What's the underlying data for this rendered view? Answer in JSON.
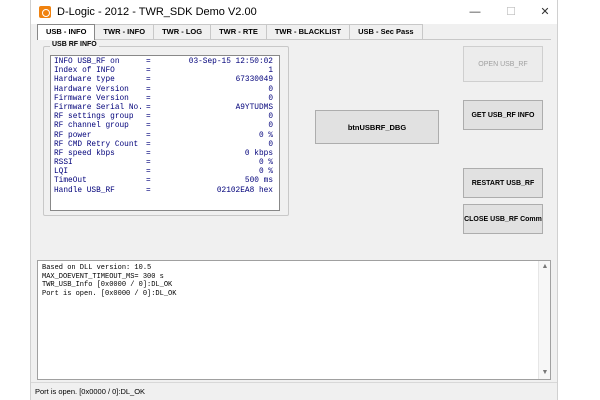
{
  "window": {
    "title": "D-Logic - 2012 - TWR_SDK Demo V2.00",
    "minimize_glyph": "—",
    "maximize_glyph": "☐",
    "close_glyph": "✕"
  },
  "tabs": [
    {
      "label": "USB - INFO",
      "active": true
    },
    {
      "label": "TWR - INFO",
      "active": false
    },
    {
      "label": "TWR - LOG",
      "active": false
    },
    {
      "label": "TWR - RTE",
      "active": false
    },
    {
      "label": "TWR - BLACKLIST",
      "active": false
    },
    {
      "label": "USB - Sec Pass",
      "active": false
    }
  ],
  "info_group": {
    "title": "USB RF INFO",
    "rows": [
      {
        "key": "INFO USB_RF on",
        "eq": "=",
        "value": "03-Sep-15 12:50:02"
      },
      {
        "key": "Index of INFO",
        "eq": "=",
        "value": "1"
      },
      {
        "key": "Hardware type",
        "eq": "=",
        "value": "67330049"
      },
      {
        "key": "Hardware Version",
        "eq": "=",
        "value": "0"
      },
      {
        "key": "Firmware Version",
        "eq": "=",
        "value": "0"
      },
      {
        "key": "Firmware Serial No.",
        "eq": "=",
        "value": "A9YTUDMS"
      },
      {
        "key": "RF settings group",
        "eq": "=",
        "value": "0"
      },
      {
        "key": "RF channel group",
        "eq": "=",
        "value": "0"
      },
      {
        "key": "RF power",
        "eq": "=",
        "value": "0 %"
      },
      {
        "key": "RF CMD Retry Count",
        "eq": "=",
        "value": "0"
      },
      {
        "key": "RF speed kbps",
        "eq": "=",
        "value": "0 kbps"
      },
      {
        "key": "RSSI",
        "eq": "=",
        "value": "0 %"
      },
      {
        "key": "LQI",
        "eq": "=",
        "value": "0 %"
      },
      {
        "key": "TimeOut",
        "eq": "=",
        "value": "500 ms"
      },
      {
        "key": "Handle USB_RF",
        "eq": "=",
        "value": "02102EA8 hex"
      }
    ]
  },
  "buttons": {
    "open": "OPEN USB_RF",
    "get_info": "GET USB_RF INFO",
    "dbg": "btnUSBRF_DBG",
    "restart": "RESTART USB_RF",
    "close": "CLOSE USB_RF Comm"
  },
  "log": {
    "lines": [
      "Based on DLL version: 10.5",
      "MAX_DOEVENT_TIMEOUT_MS= 300 s",
      "TWR_USB_Info [0x0000 / 0]:DL_OK",
      "Port is open. [0x0000 / 0]:DL_OK"
    ],
    "scroll_up": "▲",
    "scroll_down": "▼"
  },
  "status": {
    "text": "Port is open. [0x0000 / 0]:DL_OK"
  }
}
